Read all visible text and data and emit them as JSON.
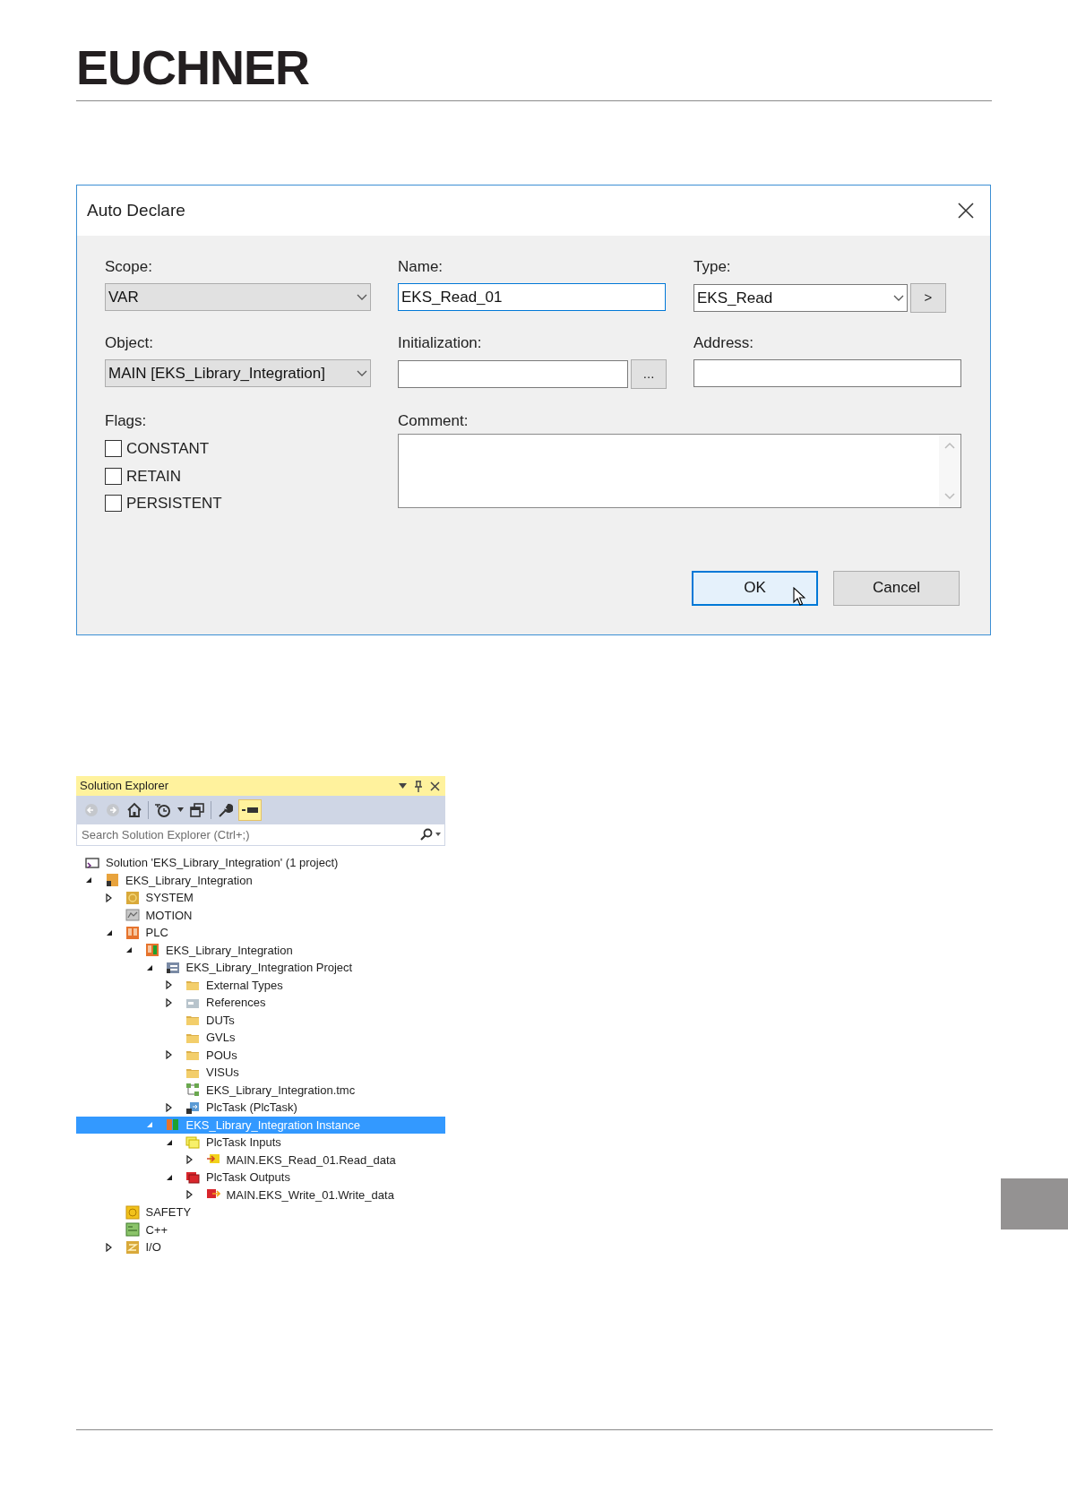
{
  "logo": {
    "text": "EUCHNER"
  },
  "dialog": {
    "title": "Auto Declare",
    "fields": [
      {
        "label": "Scope:",
        "kind": "readonly-combo",
        "value": "VAR",
        "focused": false
      },
      {
        "label": "Name:",
        "kind": "text",
        "value": "EKS_Read_01",
        "focused": true
      },
      {
        "label": "Type:",
        "kind": "combo",
        "value": "EKS_Read",
        "button": ">",
        "focused": false
      },
      {
        "label": "Object:",
        "kind": "readonly-combo",
        "value": "MAIN [EKS_Library_Integration]",
        "focused": false
      },
      {
        "label": "Initialization:",
        "kind": "text",
        "button": "...",
        "focused": false
      },
      {
        "label": "Address:",
        "kind": "text",
        "focused": false
      }
    ],
    "flags": {
      "label": "Flags:",
      "items": [
        {
          "label": "CONSTANT",
          "checked": false
        },
        {
          "label": "RETAIN",
          "checked": false
        },
        {
          "label": "PERSISTENT",
          "checked": false
        }
      ]
    },
    "comment": {
      "label": "Comment:"
    },
    "buttons": [
      {
        "label": "OK",
        "default": true
      },
      {
        "label": "Cancel",
        "default": false
      }
    ]
  },
  "solution_explorer": {
    "title": "Solution Explorer",
    "search": {
      "placeholder": "Search Solution Explorer (Ctrl+;)"
    },
    "tree": [
      {
        "label": "Solution 'EKS_Library_Integration' (1 project)",
        "kind": "solution",
        "selected": false,
        "children": [
          {
            "label": "EKS_Library_Integration",
            "kind": "project",
            "expanded": true,
            "selected": false,
            "children": [
              {
                "label": "SYSTEM",
                "kind": "system",
                "expanded": false,
                "selected": false
              },
              {
                "label": "MOTION",
                "kind": "motion",
                "selected": false
              },
              {
                "label": "PLC",
                "kind": "plc",
                "expanded": true,
                "selected": false,
                "children": [
                  {
                    "label": "EKS_Library_Integration",
                    "kind": "plc-project",
                    "expanded": true,
                    "selected": false,
                    "children": [
                      {
                        "label": "EKS_Library_Integration Project",
                        "kind": "plc-code",
                        "expanded": true,
                        "selected": false,
                        "children": [
                          {
                            "label": "External Types",
                            "kind": "folder",
                            "expanded": false,
                            "selected": false
                          },
                          {
                            "label": "References",
                            "kind": "references",
                            "expanded": false,
                            "selected": false
                          },
                          {
                            "label": "DUTs",
                            "kind": "folder",
                            "selected": false
                          },
                          {
                            "label": "GVLs",
                            "kind": "folder",
                            "selected": false
                          },
                          {
                            "label": "POUs",
                            "kind": "folder",
                            "expanded": false,
                            "selected": false
                          },
                          {
                            "label": "VISUs",
                            "kind": "folder",
                            "selected": false
                          },
                          {
                            "label": "EKS_Library_Integration.tmc",
                            "kind": "tmc",
                            "selected": false
                          },
                          {
                            "label": "PlcTask (PlcTask)",
                            "kind": "task",
                            "expanded": false,
                            "selected": false
                          }
                        ]
                      },
                      {
                        "label": "EKS_Library_Integration Instance",
                        "kind": "instance",
                        "expanded": true,
                        "selected": true,
                        "children": [
                          {
                            "label": "PlcTask Inputs",
                            "kind": "inputs",
                            "expanded": true,
                            "selected": false,
                            "children": [
                              {
                                "label": "MAIN.EKS_Read_01.Read_data",
                                "kind": "input-var",
                                "expanded": false,
                                "selected": false
                              }
                            ]
                          },
                          {
                            "label": "PlcTask Outputs",
                            "kind": "outputs",
                            "expanded": true,
                            "selected": false,
                            "children": [
                              {
                                "label": "MAIN.EKS_Write_01.Write_data",
                                "kind": "output-var",
                                "expanded": false,
                                "selected": false
                              }
                            ]
                          }
                        ]
                      }
                    ]
                  }
                ]
              },
              {
                "label": "SAFETY",
                "kind": "safety",
                "selected": false
              },
              {
                "label": "C++",
                "kind": "cpp",
                "selected": false
              },
              {
                "label": "I/O",
                "kind": "io",
                "expanded": false,
                "selected": false
              }
            ]
          }
        ]
      }
    ]
  }
}
